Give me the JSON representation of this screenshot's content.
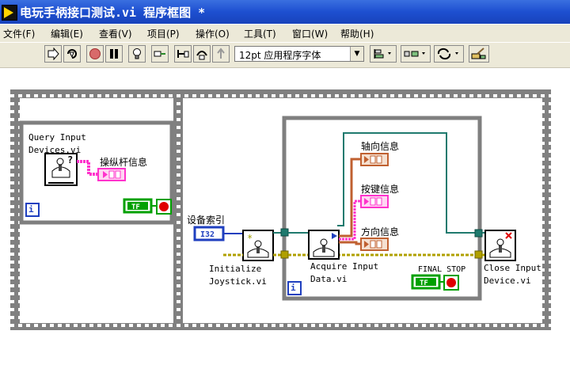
{
  "window": {
    "title": "电玩手柄接口测试.vi 程序框图 *"
  },
  "menu": {
    "items": [
      "文件(F)",
      "编辑(E)",
      "查看(V)",
      "项目(P)",
      "操作(O)",
      "工具(T)",
      "窗口(W)",
      "帮助(H)"
    ]
  },
  "toolbar": {
    "font_select_value": "12pt 应用程序字体"
  },
  "diagram": {
    "query_vi_label_line1": "Query Input",
    "query_vi_label_line2": "Devices.vi",
    "joystick_info_label": "操纵杆信息",
    "left_tf_label": "TF",
    "left_iteration": "i",
    "device_index_label": "设备索引",
    "i32_label": "I32",
    "init_vi_label_line1": "Initialize",
    "init_vi_label_line2": "Joystick.vi",
    "acquire_vi_label_line1": "Acquire Input",
    "acquire_vi_label_line2": "Data.vi",
    "axis_info_label": "轴向信息",
    "button_info_label": "按键信息",
    "pov_info_label": "方向信息",
    "final_stop_label": "FINAL STOP",
    "inner_tf_label": "TF",
    "inner_iteration": "i",
    "close_vi_label_line1": "Close Input",
    "close_vi_label_line2": "Device.vi"
  },
  "colors": {
    "titlebar": "#1d4fd0",
    "chrome": "#ece9d8",
    "structure_gray": "#7f7f7f",
    "cluster_pink": "#ff33cc",
    "refnum_teal": "#1f7a6e",
    "error_yellow": "#b0a000",
    "i32_blue": "#1f3fbf",
    "bool_green": "#00a000",
    "stop_red": "#e00000"
  }
}
